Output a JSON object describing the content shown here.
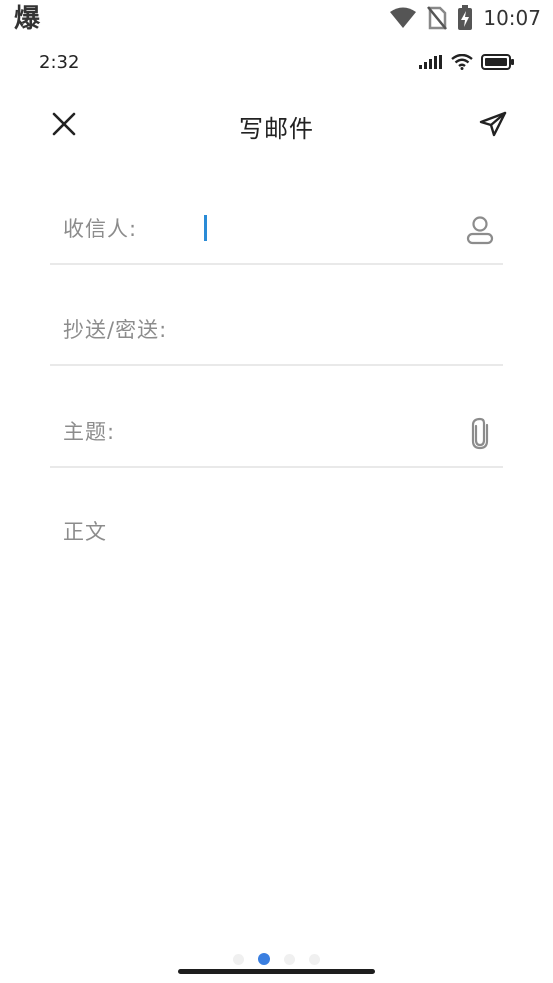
{
  "os_status": {
    "app_glyph": "爆",
    "time": "10:07",
    "icons": [
      "wifi-icon",
      "no-sim-icon",
      "battery-charging-icon"
    ]
  },
  "app_status": {
    "time": "2:32",
    "icons": [
      "signal-icon",
      "wifi-icon",
      "battery-icon"
    ]
  },
  "header": {
    "title": "写邮件",
    "close_icon": "close-icon",
    "send_icon": "send-icon"
  },
  "form": {
    "to_label": "收信人:",
    "to_value": "",
    "to_icon": "contact-icon",
    "cc_label": "抄送/密送:",
    "cc_value": "",
    "subject_label": "主题:",
    "subject_value": "",
    "subject_icon": "attachment-icon",
    "body_placeholder": "正文"
  },
  "pager": {
    "count": 4,
    "active_index": 1
  },
  "colors": {
    "accent": "#3b7fe0",
    "caret": "#2a8bd6",
    "label": "#8c8c8c",
    "divider": "#e9e9e9"
  }
}
